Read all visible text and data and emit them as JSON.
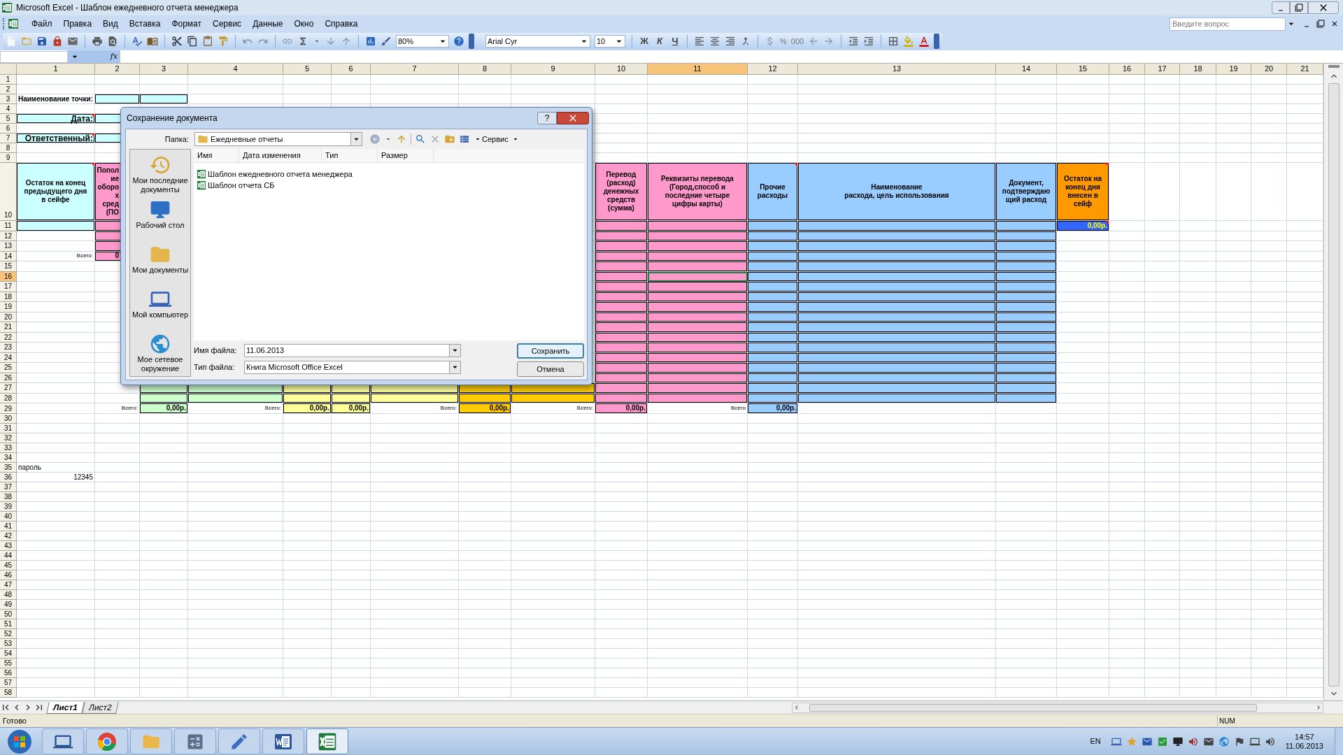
{
  "window": {
    "title": "Microsoft Excel - Шаблон ежедневного отчета менеджера"
  },
  "menu": [
    "Файл",
    "Правка",
    "Вид",
    "Вставка",
    "Формат",
    "Сервис",
    "Данные",
    "Окно",
    "Справка"
  ],
  "help_field": {
    "placeholder": "Введите вопрос"
  },
  "toolbar": {
    "zoom": "80%",
    "font": "Arial Cyr",
    "font_size": "10",
    "style_buttons": [
      "Ж",
      "К",
      "Ч"
    ],
    "number_buttons": [
      "%",
      "000"
    ]
  },
  "formula_bar": {
    "function_label": "fx"
  },
  "sheet": {
    "columns": [
      {
        "label": "1",
        "selected": false
      },
      {
        "label": "2",
        "selected": false
      },
      {
        "label": "3",
        "selected": false
      },
      {
        "label": "4",
        "selected": false
      },
      {
        "label": "5",
        "selected": false
      },
      {
        "label": "6",
        "selected": false
      },
      {
        "label": "7",
        "selected": false
      },
      {
        "label": "8",
        "selected": false
      },
      {
        "label": "9",
        "selected": false
      },
      {
        "label": "10",
        "selected": false
      },
      {
        "label": "11",
        "selected": true
      },
      {
        "label": "12",
        "selected": false
      },
      {
        "label": "13",
        "selected": false
      },
      {
        "label": "14",
        "selected": false
      },
      {
        "label": "15",
        "selected": false
      },
      {
        "label": "16",
        "selected": false
      },
      {
        "label": "17",
        "selected": false
      },
      {
        "label": "18",
        "selected": false
      },
      {
        "label": "19",
        "selected": false
      },
      {
        "label": "20",
        "selected": false
      },
      {
        "label": "21",
        "selected": false
      }
    ],
    "rows": [
      {
        "label": "1",
        "selected": false
      },
      {
        "label": "2",
        "selected": false
      },
      {
        "label": "3",
        "selected": false,
        "cells": [
          {
            "text": "Наименование точки:",
            "kind": "caption",
            "comment": false
          },
          {
            "color": "#ccffff"
          },
          {
            "color": "#ccffff"
          }
        ]
      },
      {
        "label": "4",
        "selected": false
      },
      {
        "label": "5",
        "selected": false,
        "cells": [
          {
            "text": "Дата:",
            "kind": "label",
            "color": "#ccffff",
            "comment": true
          },
          {
            "color": "#ccffff"
          }
        ]
      },
      {
        "label": "6",
        "selected": false
      },
      {
        "label": "7",
        "selected": false,
        "cells": [
          {
            "text": "Ответственный:",
            "kind": "label",
            "color": "#ccffff",
            "comment": true
          },
          {
            "color": "#ccffff"
          }
        ]
      },
      {
        "label": "8",
        "selected": false
      },
      {
        "label": "9",
        "selected": false
      },
      {
        "label": "10",
        "selected": false,
        "cells": [
          {
            "text": "Остаток на конец\nпредыдущего дня\nв сейфе",
            "kind": "header",
            "color": "#ccffff",
            "comment": true
          },
          {
            "text": "Попол\nие\nоборо\nх\nсред\n(ПО",
            "kind": "fragment",
            "color": "#ff99cc",
            "comment": false
          },
          null,
          null,
          null,
          null,
          null,
          null,
          null,
          {
            "text": "Перевод\n(расход)\nденежных\nсредств\n(сумма)",
            "kind": "header",
            "color": "#ff99cc",
            "comment": false
          },
          {
            "text": "Реквизиты перевода\n(Город,способ и\nпоследние четыре\nцифры карты)",
            "kind": "header",
            "color": "#ff99cc",
            "comment": false
          },
          {
            "text": "Прочие\nрасходы",
            "kind": "header",
            "color": "#99ccff",
            "comment": true
          },
          {
            "text": "Наименование\nрасхода, цель использования",
            "kind": "header",
            "color": "#99ccff",
            "comment": false
          },
          {
            "text": "Документ,\nподтверждаю\nщий расход",
            "kind": "header",
            "color": "#99ccff",
            "comment": false
          },
          {
            "text": "Остаток на\nконец дня\nвнесен в\nсейф",
            "kind": "header",
            "color": "#ff9900",
            "comment": true
          }
        ]
      },
      {
        "label": "11",
        "selected": false,
        "cells": [
          {
            "color": "#ccffff"
          },
          {
            "color": "#ff99cc"
          },
          null,
          null,
          null,
          null,
          null,
          null,
          null,
          {
            "color": "#ff99cc"
          },
          {
            "color": "#ff99cc"
          },
          {
            "color": "#99ccff"
          },
          {
            "color": "#99ccff"
          },
          {
            "color": "#99ccff"
          },
          {
            "text": "0,00р.",
            "kind": "balance",
            "color": "#3366ff",
            "comment": true
          }
        ]
      },
      {
        "label": "12",
        "selected": false,
        "cells": [
          null,
          {
            "color": "#ff99cc"
          },
          null,
          null,
          null,
          null,
          null,
          null,
          null,
          {
            "color": "#ff99cc"
          },
          {
            "color": "#ff99cc"
          },
          {
            "color": "#99ccff"
          },
          {
            "color": "#99ccff"
          },
          {
            "color": "#99ccff"
          }
        ]
      },
      {
        "label": "13",
        "selected": false,
        "cells": [
          null,
          {
            "color": "#ff99cc"
          },
          null,
          null,
          null,
          null,
          null,
          null,
          null,
          {
            "color": "#ff99cc"
          },
          {
            "color": "#ff99cc"
          },
          {
            "color": "#99ccff"
          },
          {
            "color": "#99ccff"
          },
          {
            "color": "#99ccff"
          }
        ]
      },
      {
        "label": "14",
        "selected": false,
        "cells": [
          {
            "text": "Всего:",
            "kind": "total_label",
            "comment": false
          },
          {
            "text": "0",
            "kind": "fragment",
            "color": "#ff99cc",
            "comment": false
          },
          null,
          null,
          null,
          null,
          null,
          null,
          null,
          {
            "color": "#ff99cc"
          },
          {
            "color": "#ff99cc"
          },
          {
            "color": "#99ccff"
          },
          {
            "color": "#99ccff"
          },
          {
            "color": "#99ccff"
          }
        ]
      },
      {
        "label": "15",
        "selected": false,
        "cells": [
          null,
          null,
          null,
          null,
          null,
          null,
          null,
          null,
          null,
          {
            "color": "#ff99cc"
          },
          {
            "color": "#ff99cc"
          },
          {
            "color": "#99ccff"
          },
          {
            "color": "#99ccff"
          },
          {
            "color": "#99ccff"
          }
        ]
      },
      {
        "label": "16",
        "selected": true,
        "cells": [
          null,
          null,
          null,
          null,
          null,
          null,
          null,
          null,
          null,
          {
            "color": "#ff99cc"
          },
          {
            "color": "#ff99cc"
          },
          {
            "color": "#99ccff"
          },
          {
            "color": "#99ccff"
          },
          {
            "color": "#99ccff"
          }
        ]
      },
      {
        "label": "17",
        "selected": false,
        "cells": [
          null,
          null,
          null,
          null,
          null,
          null,
          null,
          null,
          null,
          {
            "color": "#ff99cc"
          },
          {
            "color": "#ff99cc"
          },
          {
            "color": "#99ccff"
          },
          {
            "color": "#99ccff"
          },
          {
            "color": "#99ccff"
          }
        ]
      },
      {
        "label": "18",
        "selected": false,
        "cells": [
          null,
          null,
          null,
          null,
          null,
          null,
          null,
          null,
          null,
          {
            "color": "#ff99cc"
          },
          {
            "color": "#ff99cc"
          },
          {
            "color": "#99ccff"
          },
          {
            "color": "#99ccff"
          },
          {
            "color": "#99ccff"
          }
        ]
      },
      {
        "label": "19",
        "selected": false,
        "cells": [
          null,
          null,
          null,
          null,
          null,
          null,
          null,
          null,
          null,
          {
            "color": "#ff99cc"
          },
          {
            "color": "#ff99cc"
          },
          {
            "color": "#99ccff"
          },
          {
            "color": "#99ccff"
          },
          {
            "color": "#99ccff"
          }
        ]
      },
      {
        "label": "20",
        "selected": false,
        "cells": [
          null,
          null,
          null,
          null,
          null,
          null,
          null,
          null,
          null,
          {
            "color": "#ff99cc"
          },
          {
            "color": "#ff99cc"
          },
          {
            "color": "#99ccff"
          },
          {
            "color": "#99ccff"
          },
          {
            "color": "#99ccff"
          }
        ]
      },
      {
        "label": "21",
        "selected": false,
        "cells": [
          null,
          null,
          null,
          null,
          null,
          null,
          null,
          null,
          null,
          {
            "color": "#ff99cc"
          },
          {
            "color": "#ff99cc"
          },
          {
            "color": "#99ccff"
          },
          {
            "color": "#99ccff"
          },
          {
            "color": "#99ccff"
          }
        ]
      },
      {
        "label": "22",
        "selected": false,
        "cells": [
          null,
          null,
          null,
          null,
          null,
          null,
          null,
          null,
          null,
          {
            "color": "#ff99cc"
          },
          {
            "color": "#ff99cc"
          },
          {
            "color": "#99ccff"
          },
          {
            "color": "#99ccff"
          },
          {
            "color": "#99ccff"
          }
        ]
      },
      {
        "label": "23",
        "selected": false,
        "cells": [
          null,
          null,
          null,
          null,
          null,
          null,
          null,
          null,
          null,
          {
            "color": "#ff99cc"
          },
          {
            "color": "#ff99cc"
          },
          {
            "color": "#99ccff"
          },
          {
            "color": "#99ccff"
          },
          {
            "color": "#99ccff"
          }
        ]
      },
      {
        "label": "24",
        "selected": false,
        "cells": [
          null,
          null,
          null,
          null,
          null,
          null,
          null,
          null,
          null,
          {
            "color": "#ff99cc"
          },
          {
            "color": "#ff99cc"
          },
          {
            "color": "#99ccff"
          },
          {
            "color": "#99ccff"
          },
          {
            "color": "#99ccff"
          }
        ]
      },
      {
        "label": "25",
        "selected": false,
        "cells": [
          null,
          null,
          null,
          null,
          null,
          null,
          null,
          null,
          null,
          {
            "color": "#ff99cc"
          },
          {
            "color": "#ff99cc"
          },
          {
            "color": "#99ccff"
          },
          {
            "color": "#99ccff"
          },
          {
            "color": "#99ccff"
          }
        ]
      },
      {
        "label": "26",
        "selected": false,
        "cells": [
          null,
          null,
          null,
          null,
          null,
          null,
          null,
          null,
          null,
          {
            "color": "#ff99cc"
          },
          {
            "color": "#ff99cc"
          },
          {
            "color": "#99ccff"
          },
          {
            "color": "#99ccff"
          },
          {
            "color": "#99ccff"
          }
        ]
      },
      {
        "label": "27",
        "selected": false,
        "cells": [
          null,
          null,
          {
            "color": "#ccffcc"
          },
          {
            "color": "#ccffcc"
          },
          {
            "color": "#ffff99"
          },
          {
            "color": "#ffff99"
          },
          {
            "color": "#ffff99"
          },
          {
            "color": "#ffcc00"
          },
          {
            "color": "#ffcc00"
          },
          {
            "color": "#ff99cc"
          },
          {
            "color": "#ff99cc"
          },
          {
            "color": "#99ccff"
          },
          {
            "color": "#99ccff"
          },
          {
            "color": "#99ccff"
          }
        ]
      },
      {
        "label": "28",
        "selected": false,
        "cells": [
          null,
          null,
          {
            "color": "#ccffcc"
          },
          {
            "color": "#ccffcc"
          },
          {
            "color": "#ffff99"
          },
          {
            "color": "#ffff99"
          },
          {
            "color": "#ffff99"
          },
          {
            "color": "#ffcc00"
          },
          {
            "color": "#ffcc00"
          },
          {
            "color": "#ff99cc"
          },
          {
            "color": "#ff99cc"
          },
          {
            "color": "#99ccff"
          },
          {
            "color": "#99ccff"
          },
          {
            "color": "#99ccff"
          }
        ]
      },
      {
        "label": "29",
        "selected": false,
        "cells": [
          null,
          {
            "text": "Всего:",
            "kind": "total_label",
            "comment": false
          },
          {
            "text": "0,00р.",
            "kind": "total",
            "color": "#ccffcc",
            "comment": false
          },
          {
            "text": "Всего:",
            "kind": "total_label",
            "comment": false
          },
          {
            "text": "0,00р.",
            "kind": "total",
            "color": "#ffff99",
            "comment": false
          },
          {
            "text": "0,00р.",
            "kind": "total",
            "color": "#ffff99",
            "comment": false
          },
          {
            "text": "Всего:",
            "kind": "total_label",
            "comment": false
          },
          {
            "text": "0,00р.",
            "kind": "total",
            "color": "#ffcc00",
            "comment": false
          },
          {
            "text": "Всего:",
            "kind": "total_label",
            "comment": false
          },
          {
            "text": "0,00р.",
            "kind": "total",
            "color": "#ff99cc",
            "comment": false
          },
          {
            "text": "Всего",
            "kind": "total_label",
            "comment": false
          },
          {
            "text": "0,00р.",
            "kind": "total",
            "color": "#99ccff",
            "comment": false
          }
        ]
      },
      {
        "label": "30",
        "selected": false
      },
      {
        "label": "31",
        "selected": false
      },
      {
        "label": "32",
        "selected": false
      },
      {
        "label": "33",
        "selected": false
      },
      {
        "label": "34",
        "selected": false
      },
      {
        "label": "35",
        "selected": false,
        "cells": [
          {
            "text": "пароль",
            "kind": "text",
            "comment": false
          }
        ]
      },
      {
        "label": "36",
        "selected": false,
        "cells": [
          {
            "text": "12345",
            "kind": "number",
            "comment": false
          }
        ]
      },
      {
        "label": "37",
        "selected": false
      },
      {
        "label": "38",
        "selected": false
      },
      {
        "label": "39",
        "selected": false
      },
      {
        "label": "40",
        "selected": false
      },
      {
        "label": "41",
        "selected": false
      },
      {
        "label": "42",
        "selected": false
      },
      {
        "label": "43",
        "selected": false
      },
      {
        "label": "44",
        "selected": false
      },
      {
        "label": "45",
        "selected": false
      },
      {
        "label": "46",
        "selected": false
      },
      {
        "label": "47",
        "selected": false
      },
      {
        "label": "48",
        "selected": false
      },
      {
        "label": "49",
        "selected": false
      },
      {
        "label": "50",
        "selected": false
      },
      {
        "label": "51",
        "selected": false
      },
      {
        "label": "52",
        "selected": false
      },
      {
        "label": "53",
        "selected": false
      },
      {
        "label": "54",
        "selected": false
      },
      {
        "label": "55",
        "selected": false
      },
      {
        "label": "56",
        "selected": false
      },
      {
        "label": "57",
        "selected": false
      },
      {
        "label": "58",
        "selected": false
      }
    ]
  },
  "sheet_tabs": [
    {
      "label": "Лист1",
      "selected": true
    },
    {
      "label": "Лист2",
      "selected": false
    }
  ],
  "status_bar": {
    "text": "Готово",
    "indicator": "NUM"
  },
  "dialog": {
    "title": "Сохранение документа",
    "help": "?",
    "folder_label": "Папка:",
    "folder": "Ежедневные отчеты",
    "tools_label": "Сервис",
    "places": [
      {
        "label": "Мои последние документы",
        "kind": "recent"
      },
      {
        "label": "Рабочий стол",
        "kind": "desktop"
      },
      {
        "label": "Мои документы",
        "kind": "documents"
      },
      {
        "label": "Мой компьютер",
        "kind": "computer"
      },
      {
        "label": "Мое сетевое окружение",
        "kind": "network"
      }
    ],
    "columns": [
      "Имя",
      "Дата изменения",
      "Тип",
      "Размер"
    ],
    "files": [
      "Шаблон ежедневного отчета менеджера",
      "Шаблон отчета СБ"
    ],
    "fields": [
      {
        "label": "Имя файла:",
        "value": "11.06.2013"
      },
      {
        "label": "Тип файла:",
        "value": "Книга Microsoft Office Excel"
      }
    ],
    "buttons": [
      {
        "label": "Сохранить",
        "default": true
      },
      {
        "label": "Отмена",
        "default": false
      }
    ]
  },
  "taskbar": {
    "apps": [
      {
        "kind": "monitor",
        "selected": false
      },
      {
        "kind": "browser",
        "selected": false
      },
      {
        "kind": "folder",
        "selected": false
      },
      {
        "kind": "calculator",
        "selected": false
      },
      {
        "kind": "pen",
        "selected": false
      },
      {
        "kind": "document",
        "selected": false
      },
      {
        "kind": "spreadsheet",
        "selected": true
      }
    ],
    "language": "EN",
    "time": "14:57",
    "date": "11.06.2013"
  }
}
